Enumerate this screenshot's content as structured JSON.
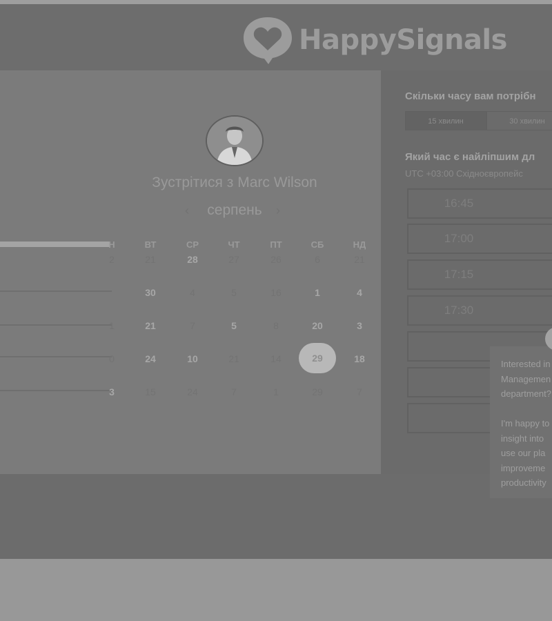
{
  "brand": {
    "name": "HappySignals"
  },
  "meeting": {
    "title": "Зустрітися з Marc Wilson",
    "month": "серпень",
    "prev_icon": "‹",
    "next_icon": "›"
  },
  "calendar": {
    "weekdays": [
      "Н",
      "ВТ",
      "СР",
      "ЧТ",
      "ПТ",
      "СБ",
      "НД"
    ],
    "weeks": [
      {
        "days": [
          {
            "label": "2",
            "state": "disabled"
          },
          {
            "label": "21",
            "state": "disabled"
          },
          {
            "label": "28",
            "state": "available"
          },
          {
            "label": "27",
            "state": "disabled"
          },
          {
            "label": "26",
            "state": "disabled"
          },
          {
            "label": "6",
            "state": "disabled"
          },
          {
            "label": "21",
            "state": "disabled"
          }
        ]
      },
      {
        "days": [
          {
            "label": "",
            "state": "disabled"
          },
          {
            "label": "30",
            "state": "available"
          },
          {
            "label": "4",
            "state": "disabled"
          },
          {
            "label": "5",
            "state": "disabled"
          },
          {
            "label": "16",
            "state": "disabled"
          },
          {
            "label": "1",
            "state": "available"
          },
          {
            "label": "4",
            "state": "available"
          }
        ]
      },
      {
        "days": [
          {
            "label": "1",
            "state": "disabled"
          },
          {
            "label": "21",
            "state": "available"
          },
          {
            "label": "7",
            "state": "disabled"
          },
          {
            "label": "5",
            "state": "available"
          },
          {
            "label": "8",
            "state": "disabled"
          },
          {
            "label": "20",
            "state": "available"
          },
          {
            "label": "3",
            "state": "available"
          }
        ]
      },
      {
        "days": [
          {
            "label": "0",
            "state": "disabled"
          },
          {
            "label": "24",
            "state": "available"
          },
          {
            "label": "10",
            "state": "available"
          },
          {
            "label": "21",
            "state": "disabled"
          },
          {
            "label": "14",
            "state": "disabled"
          },
          {
            "label": "29",
            "state": "selected"
          },
          {
            "label": "18",
            "state": "available"
          }
        ]
      },
      {
        "days": [
          {
            "label": "3",
            "state": "available"
          },
          {
            "label": "15",
            "state": "disabled"
          },
          {
            "label": "24",
            "state": "disabled"
          },
          {
            "label": "7",
            "state": "disabled"
          },
          {
            "label": "1",
            "state": "disabled"
          },
          {
            "label": "29",
            "state": "disabled"
          },
          {
            "label": "7",
            "state": "disabled"
          }
        ]
      }
    ]
  },
  "duration": {
    "question": "Скільки часу вам потрібн",
    "options": [
      {
        "label": "15 хвилин",
        "active": true
      },
      {
        "label": "30 хвилин",
        "active": false
      }
    ]
  },
  "time": {
    "question": "Який час є найліпшим дл",
    "timezone": "UTC +03:00 Східноєвропейс",
    "slots": [
      "16:45",
      "17:00",
      "17:15",
      "17:30",
      "",
      "",
      ""
    ]
  },
  "chat": {
    "lines": [
      "Interested in",
      "Managemen",
      "department?",
      "",
      "I'm happy to",
      "insight into",
      "use our pla",
      "improveme",
      "productivity"
    ]
  },
  "icons": {
    "logo": "heart-speech-bubble-icon",
    "avatar": "person-portrait-icon",
    "chat_close": "close-icon"
  }
}
